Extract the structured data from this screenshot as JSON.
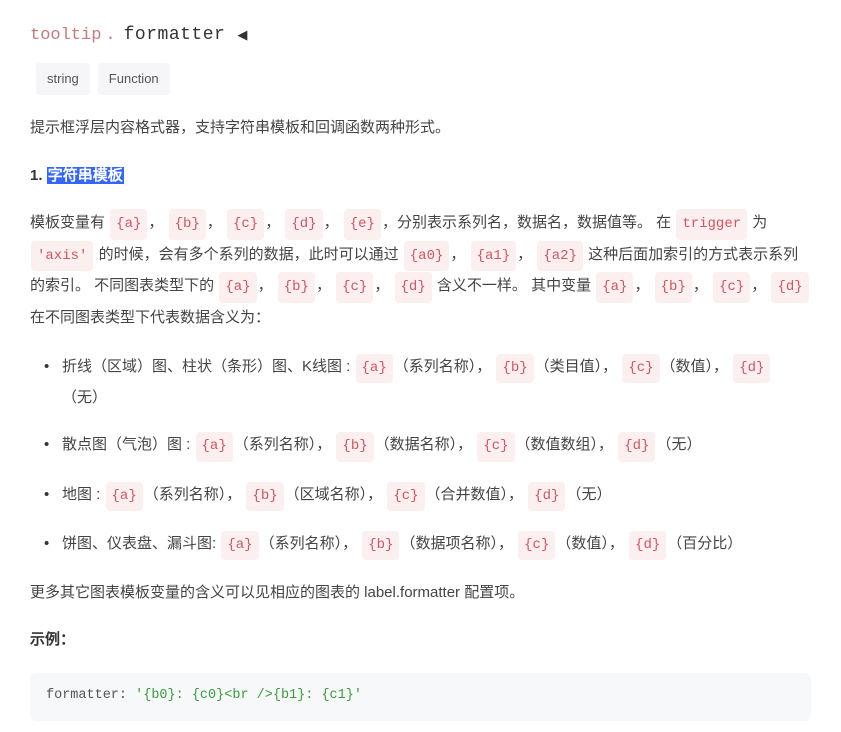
{
  "breadcrumb": {
    "parent": "tooltip",
    "dot": ".",
    "current": "formatter"
  },
  "tags": [
    "string",
    "Function"
  ],
  "intro": "提示框浮层内容格式器，支持字符串模板和回调函数两种形式。",
  "section1": {
    "num": "1. ",
    "title": "字符串模板"
  },
  "para1": {
    "t1": "模板变量有 ",
    "a": "{a}",
    "c1": "，",
    "b": "{b}",
    "c2": "， ",
    "c": "{c}",
    "c3": "， ",
    "d": "{d}",
    "c4": "， ",
    "e": "{e}",
    "t2": "，分别表示系列名，数据名，数据值等。 在 ",
    "trigger": "trigger",
    "t3": " 为 ",
    "axis": "'axis'",
    "t4": " 的时候，会有多个系列的数据，此时可以通过 ",
    "a0": "{a0}",
    "c5": "，",
    "a1": "{a1}",
    "c6": "，",
    "a2": "{a2}",
    "t5": " 这种后面加索引的方式表示系列的索引。 不同图表类型下的 ",
    "aa": "{a}",
    "c7": "， ",
    "bb": "{b}",
    "c8": "， ",
    "cc": "{c}",
    "c9": "， ",
    "dd": "{d}",
    "t6": " 含义不一样。 其中变量 ",
    "aaa": "{a}",
    "c10": "，",
    "bbb": "{b}",
    "c11": "，",
    "ccc": "{c}",
    "c12": "，",
    "ddd": "{d}",
    "t7": " 在不同图表类型下代表数据含义为："
  },
  "li1": {
    "t1": "折线（区域）图、柱状（条形）图、K线图 : ",
    "a": "{a}",
    "l1": "（系列名称），",
    "b": "{b}",
    "l2": "（类目值），",
    "c": "{c}",
    "l3": "（数值），",
    "d": "{d}",
    "l4": "（无）"
  },
  "li2": {
    "t1": "散点图（气泡）图 : ",
    "a": "{a}",
    "l1": "（系列名称），",
    "b": "{b}",
    "l2": "（数据名称），",
    "c": "{c}",
    "l3": "（数值数组），",
    "d": "{d}",
    "l4": "（无）"
  },
  "li3": {
    "t1": "地图 : ",
    "a": "{a}",
    "l1": "（系列名称），",
    "b": "{b}",
    "l2": "（区域名称），",
    "c": "{c}",
    "l3": "（合并数值），",
    "d": "{d}",
    "l4": "（无）"
  },
  "li4": {
    "t1": "饼图、仪表盘、漏斗图: ",
    "a": "{a}",
    "l1": "（系列名称），",
    "b": "{b}",
    "l2": "（数据项名称），",
    "c": "{c}",
    "l3": "（数值），",
    "d": "{d}",
    "l4": "（百分比）"
  },
  "more": "更多其它图表模板变量的含义可以见相应的图表的 label.formatter 配置项。",
  "example_label": "示例：",
  "codeblock": {
    "key": "formatter: ",
    "val": "'{b0}: {c0}<br />{b1}: {c1}'"
  }
}
